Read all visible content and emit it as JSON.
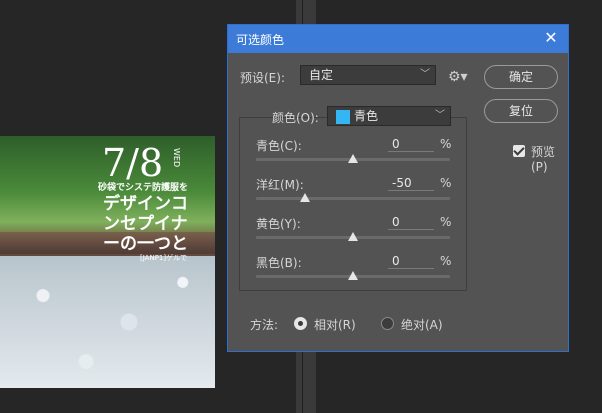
{
  "colors": {
    "accent": "#3d7bd9",
    "dialog_bg": "#535353",
    "swatch": "#35b6f4"
  },
  "poster": {
    "date": "7/8",
    "weekday": "WED",
    "subtitle": "砂袋でシステ防護服を",
    "title_lines": [
      "デザインコ",
      "ンセプイナ",
      "ーの一つと"
    ],
    "small_text": "[JANP1]ゲルで"
  },
  "dialog": {
    "title": "可选颜色",
    "close_icon": "close-icon",
    "preset_label": "预设(E):",
    "preset_value": "自定",
    "ok_label": "确定",
    "reset_label": "复位",
    "preview_label": "预览(P)",
    "preview_checked": true,
    "colors_label": "颜色(O):",
    "colors_value": "青色",
    "sliders": [
      {
        "label": "青色(C):",
        "value": "0",
        "unit": "%",
        "level": 0
      },
      {
        "label": "洋红(M):",
        "value": "-50",
        "unit": "%",
        "level": -50
      },
      {
        "label": "黄色(Y):",
        "value": "0",
        "unit": "%",
        "level": 0
      },
      {
        "label": "黑色(B):",
        "value": "0",
        "unit": "%",
        "level": 0
      }
    ],
    "method_label": "方法:",
    "method_relative": "相对(R)",
    "method_absolute": "绝对(A)",
    "method_selected": "relative"
  }
}
